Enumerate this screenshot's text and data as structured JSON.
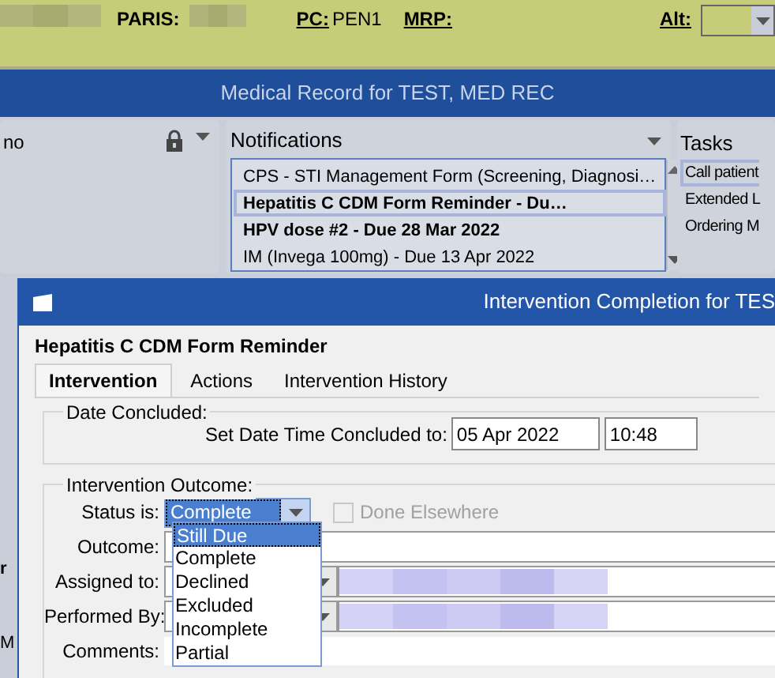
{
  "header": {
    "paris_label": "PARIS:",
    "pc_label": "PC:",
    "pc_value": "PEN1",
    "mrp_label": "MRP:",
    "alt_label": "Alt:"
  },
  "window_title": "Medical Record for TEST, MED REC",
  "left_panel": {
    "title": "no"
  },
  "notifications": {
    "title": "Notifications",
    "items": [
      {
        "text": "CPS - STI Management Form (Screening, Diagnosi…",
        "selected": false,
        "bold": false
      },
      {
        "text": "Hepatitis C CDM Form Reminder - Du…",
        "selected": true,
        "bold": true
      },
      {
        "text": "HPV dose #2  - Due 28 Mar 2022",
        "selected": false,
        "bold": true
      },
      {
        "text": "IM (Invega 100mg) - Due 13 Apr 2022",
        "selected": false,
        "bold": false
      }
    ]
  },
  "tasks": {
    "title": "Tasks",
    "items": [
      {
        "text": "Call patient",
        "selected": true
      },
      {
        "text": "Extended L",
        "selected": false
      },
      {
        "text": "Ordering M",
        "selected": false
      }
    ]
  },
  "left_strip": [
    "r",
    "M"
  ],
  "dialog": {
    "title": "Intervention Completion for TES",
    "heading": "Hepatitis C CDM Form Reminder",
    "tabs": [
      {
        "label": "Intervention",
        "selected": true
      },
      {
        "label": "Actions",
        "selected": false
      },
      {
        "label": "Intervention History",
        "selected": false
      }
    ],
    "date_group": {
      "legend": "Date Concluded:",
      "label": "Set Date Time Concluded to:",
      "date": "05 Apr 2022",
      "time": "10:48"
    },
    "outcome_group": {
      "legend": "Intervention Outcome:",
      "status_label": "Status is:",
      "status_value": "Complete",
      "done_elsewhere": {
        "label": "Done Elsewhere",
        "checked": false,
        "disabled": true
      },
      "outcome_label": "Outcome:",
      "assigned_label": "Assigned to:",
      "performed_label": "Performed By:",
      "comments_label": "Comments:"
    },
    "status_options": [
      {
        "label": "Still Due",
        "selected": true
      },
      {
        "label": "Complete",
        "selected": false
      },
      {
        "label": "Declined",
        "selected": false
      },
      {
        "label": "Excluded",
        "selected": false
      },
      {
        "label": "Incomplete",
        "selected": false
      },
      {
        "label": "Partial",
        "selected": false
      }
    ]
  }
}
